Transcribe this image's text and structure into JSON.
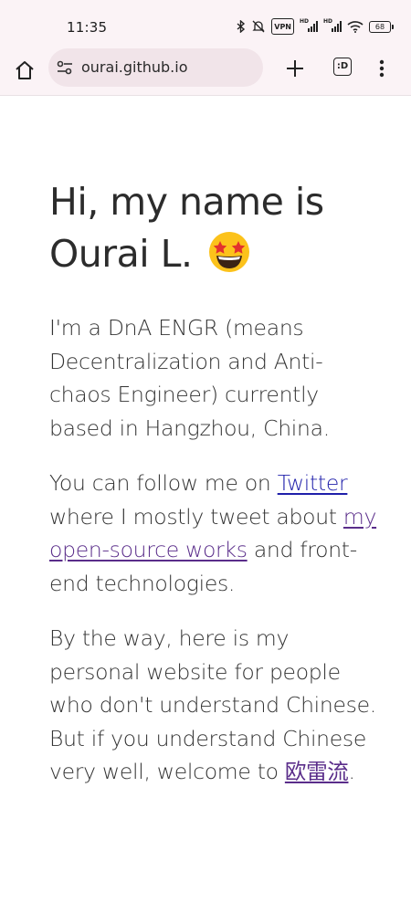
{
  "status_bar": {
    "time": "11:35",
    "vpn_label": "VPN",
    "sig1_hd": "HD",
    "sig2_hd": "HD",
    "battery": "68",
    "icons": [
      "bluetooth-icon",
      "mute-icon",
      "vpn-icon",
      "signal-icon",
      "signal-icon",
      "wifi-icon",
      "battery-icon"
    ]
  },
  "toolbar": {
    "url": "ourai.github.io",
    "tabs_label": ":D",
    "icons": [
      "home-icon",
      "site-settings-icon",
      "plus-icon",
      "tabs-icon",
      "more-vert-icon"
    ]
  },
  "page": {
    "heading": "Hi, my name is Ourai L.",
    "heading_emoji": "star-struck-emoji",
    "intro": "I'm a DnA ENGR (means Decentralization and Anti-chaos Engineer) currently based in Hangzhou, China.",
    "follow_pre": "You can follow me on ",
    "twitter_link": "Twitter",
    "follow_mid": " where I mostly tweet about ",
    "opensource_link": "my open-source works",
    "follow_post": " and front-end technologies.",
    "byway_text": "By the way, here is my personal website for people who don't understand Chinese. But if you understand Chinese very well, welcome to ",
    "chinese_link": "欧雷流",
    "byway_end": "."
  },
  "colors": {
    "toolbar_bg": "#fbf3f6",
    "url_pill_bg": "#f1e4e9",
    "link": "#1f1faa",
    "visited_link": "#5a2d8a",
    "text": "#2c2c2c"
  }
}
